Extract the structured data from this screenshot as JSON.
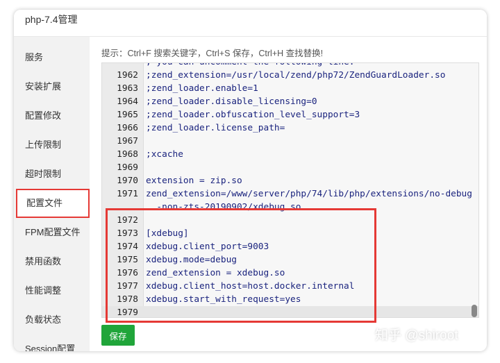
{
  "window": {
    "title": "php-7.4管理"
  },
  "sidebar": {
    "items": [
      {
        "label": "服务"
      },
      {
        "label": "安装扩展"
      },
      {
        "label": "配置修改"
      },
      {
        "label": "上传限制"
      },
      {
        "label": "超时限制"
      },
      {
        "label": "配置文件",
        "active": true
      },
      {
        "label": "FPM配置文件"
      },
      {
        "label": "禁用函数"
      },
      {
        "label": "性能调整"
      },
      {
        "label": "负载状态"
      },
      {
        "label": "Session配置"
      }
    ]
  },
  "main": {
    "hint": "提示：Ctrl+F 搜索关键字，Ctrl+S 保存，Ctrl+H 查找替换!",
    "editor": {
      "top_partial": "; you can uncomment the following line.",
      "lines": [
        {
          "n": "1962",
          "code": ";zend_extension=/usr/local/zend/php72/ZendGuardLoader.so"
        },
        {
          "n": "1963",
          "code": ";zend_loader.enable=1"
        },
        {
          "n": "1964",
          "code": ";zend_loader.disable_licensing=0"
        },
        {
          "n": "1965",
          "code": ";zend_loader.obfuscation_level_support=3"
        },
        {
          "n": "1966",
          "code": ";zend_loader.license_path="
        },
        {
          "n": "1967",
          "code": ""
        },
        {
          "n": "1968",
          "code": ";xcache"
        },
        {
          "n": "1969",
          "code": ""
        },
        {
          "n": "1970",
          "code": "extension = zip.so"
        },
        {
          "n": "1971",
          "code": "zend_extension=/www/server/php/74/lib/php/extensions/no-debug"
        },
        {
          "n": "",
          "code": "  -non-zts-20190902/xdebug.so"
        },
        {
          "n": "1972",
          "code": ""
        },
        {
          "n": "1973",
          "code": "[xdebug]"
        },
        {
          "n": "1974",
          "code": "xdebug.client_port=9003"
        },
        {
          "n": "1975",
          "code": "xdebug.mode=debug"
        },
        {
          "n": "1976",
          "code": "zend_extension = xdebug.so"
        },
        {
          "n": "1977",
          "code": "xdebug.client_host=host.docker.internal"
        },
        {
          "n": "1978",
          "code": "xdebug.start_with_request=yes"
        },
        {
          "n": "1979",
          "code": ""
        }
      ]
    },
    "save_label": "保存"
  },
  "watermark": "知乎 @shiroot",
  "colors": {
    "accent": "#20a53a",
    "highlight": "#e53935",
    "code": "#1a237e"
  }
}
